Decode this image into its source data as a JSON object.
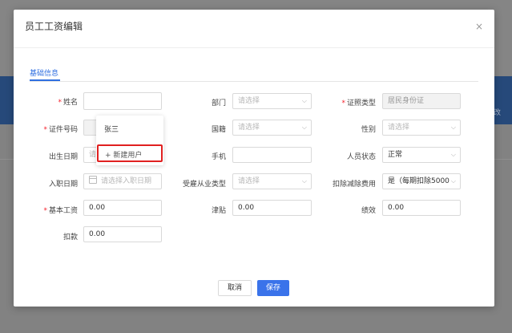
{
  "modal": {
    "title": "员工工资编辑",
    "close_glyph": "×",
    "tab": "基础信息"
  },
  "background": {
    "right_text": "改"
  },
  "form": {
    "name": {
      "label": "姓名",
      "required": true,
      "value": ""
    },
    "dept": {
      "label": "部门",
      "placeholder": "请选择"
    },
    "id_type": {
      "label": "证照类型",
      "required": true,
      "value": "居民身份证"
    },
    "id_no": {
      "label": "证件号码",
      "required": true
    },
    "nationality": {
      "label": "国籍",
      "placeholder": "请选择"
    },
    "gender": {
      "label": "性别",
      "placeholder": "请选择"
    },
    "birth": {
      "label": "出生日期",
      "placeholder": "请"
    },
    "phone": {
      "label": "手机",
      "value": ""
    },
    "status": {
      "label": "人员状态",
      "value": "正常"
    },
    "hire_date": {
      "label": "入职日期",
      "placeholder": "请选择入职日期"
    },
    "employ_type": {
      "label": "受雇从业类型",
      "placeholder": "请选择"
    },
    "deduction": {
      "label": "扣除减除费用",
      "value": "是（每期扣除5000"
    },
    "base_salary": {
      "label": "基本工资",
      "required": true,
      "value": "0.00"
    },
    "allowance": {
      "label": "津贴",
      "value": "0.00"
    },
    "performance": {
      "label": "绩效",
      "value": "0.00"
    },
    "withhold": {
      "label": "扣款",
      "value": "0.00"
    }
  },
  "dropdown": {
    "option": "张三",
    "new_user": "+ 新建用户"
  },
  "buttons": {
    "cancel": "取消",
    "save": "保存"
  },
  "icons": {
    "select": "chevron-down-icon",
    "date": "calendar-icon",
    "close": "close-icon"
  },
  "colors": {
    "primary": "#3a73ea",
    "required": "#f5222d",
    "highlight": "#e02020",
    "bg_blue": "#26497a"
  }
}
